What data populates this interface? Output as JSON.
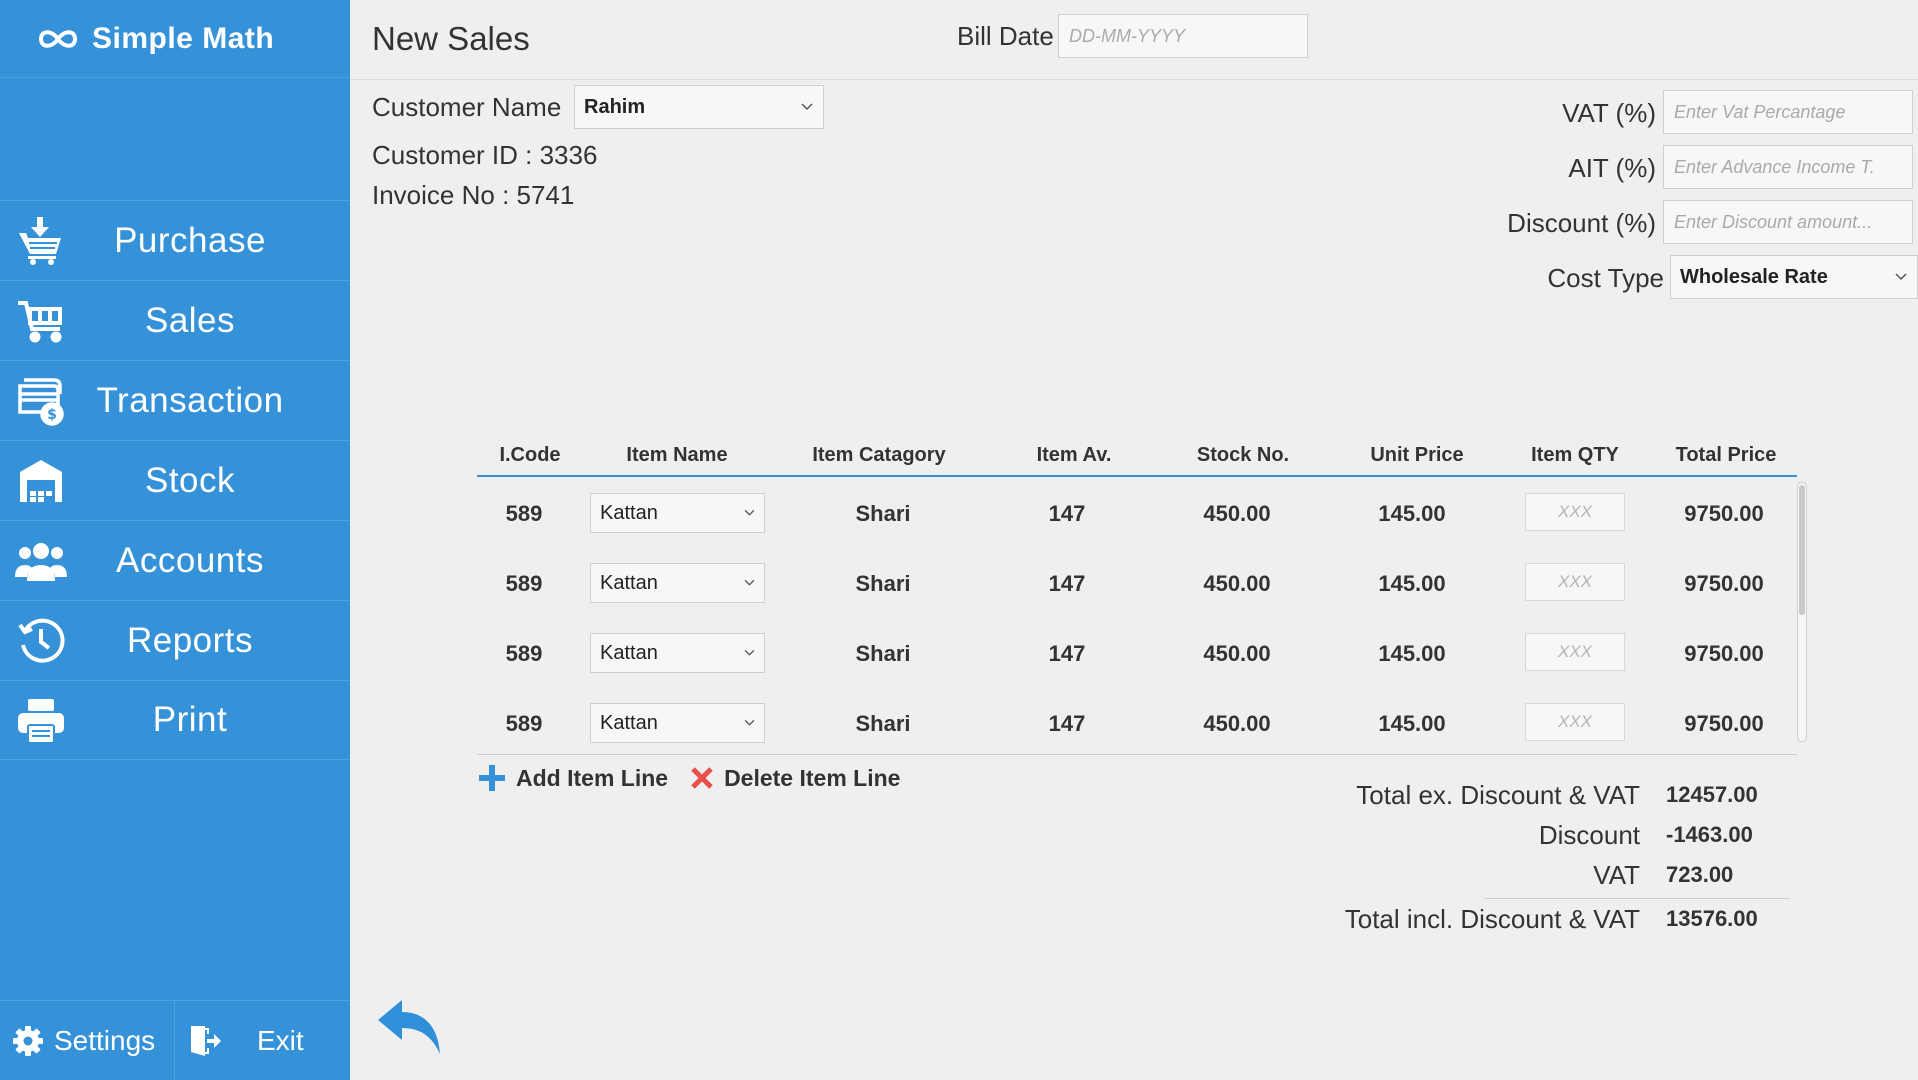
{
  "app": {
    "name": "Simple Math"
  },
  "sidebar": {
    "items": [
      {
        "label": "Purchase",
        "icon": "cart-add-icon"
      },
      {
        "label": "Sales",
        "icon": "cart-icon"
      },
      {
        "label": "Transaction",
        "icon": "money-transaction-icon"
      },
      {
        "label": "Stock",
        "icon": "warehouse-icon"
      },
      {
        "label": "Accounts",
        "icon": "users-icon"
      },
      {
        "label": "Reports",
        "icon": "history-icon"
      },
      {
        "label": "Print",
        "icon": "printer-icon"
      }
    ],
    "settings_label": "Settings",
    "exit_label": "Exit"
  },
  "header": {
    "title": "New Sales",
    "bill_date_label": "Bill Date",
    "bill_date_placeholder": "DD-MM-YYYY"
  },
  "customer": {
    "name_label": "Customer Name",
    "name_value": "Rahim",
    "id_text": "Customer ID : 3336",
    "invoice_text": "Invoice No : 5741"
  },
  "fields": {
    "vat_label": "VAT (%)",
    "vat_placeholder": "Enter Vat Percantage",
    "ait_label": "AIT (%)",
    "ait_placeholder": "Enter Advance Income T.",
    "discount_label": "Discount (%)",
    "discount_placeholder": "Enter Discount amount...",
    "cost_type_label": "Cost Type",
    "cost_type_value": "Wholesale Rate"
  },
  "table": {
    "columns": [
      "I.Code",
      "Item Name",
      "Item Catagory",
      "Item Av.",
      "Stock No.",
      "Unit Price",
      "Item QTY",
      "Total Price"
    ],
    "rows": [
      {
        "code": "589",
        "item": "Kattan",
        "category": "Shari",
        "available": "147",
        "stock_no": "450.00",
        "unit_price": "145.00",
        "qty_placeholder": "XXX",
        "total": "9750.00"
      },
      {
        "code": "589",
        "item": "Kattan",
        "category": "Shari",
        "available": "147",
        "stock_no": "450.00",
        "unit_price": "145.00",
        "qty_placeholder": "XXX",
        "total": "9750.00"
      },
      {
        "code": "589",
        "item": "Kattan",
        "category": "Shari",
        "available": "147",
        "stock_no": "450.00",
        "unit_price": "145.00",
        "qty_placeholder": "XXX",
        "total": "9750.00"
      },
      {
        "code": "589",
        "item": "Kattan",
        "category": "Shari",
        "available": "147",
        "stock_no": "450.00",
        "unit_price": "145.00",
        "qty_placeholder": "XXX",
        "total": "9750.00"
      }
    ]
  },
  "actions": {
    "add_line": "Add Item Line",
    "delete_line": "Delete Item Line"
  },
  "totals": {
    "ex_label": "Total ex. Discount & VAT",
    "ex_value": "12457.00",
    "discount_label": "Discount",
    "discount_value": "-1463.00",
    "vat_label": "VAT",
    "vat_value": "723.00",
    "incl_label": "Total incl. Discount & VAT",
    "incl_value": "13576.00"
  },
  "colors": {
    "sidebar": "#3592d8",
    "accent": "#3592d8",
    "background": "#efefef",
    "delete": "#e8514a"
  }
}
